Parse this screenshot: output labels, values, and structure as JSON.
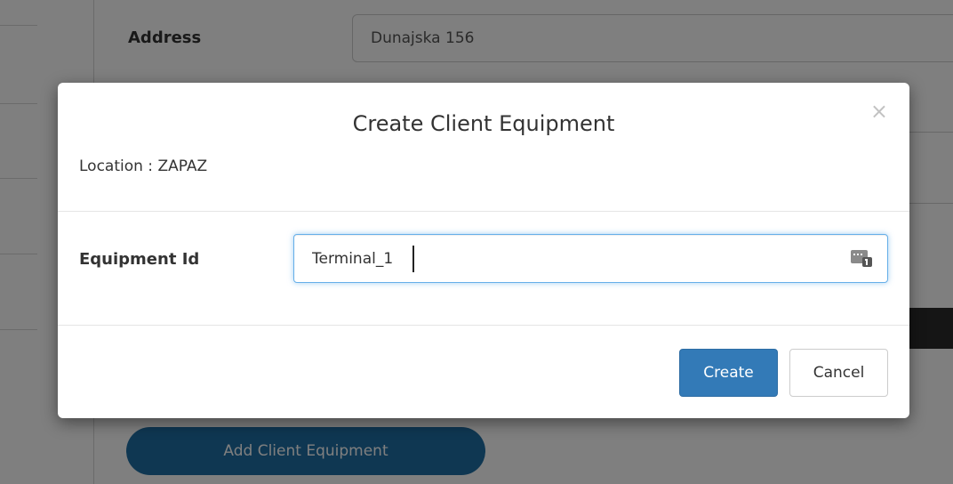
{
  "background": {
    "address_label": "Address",
    "address_value": "Dunajska 156",
    "add_equipment_button": "Add Client Equipment"
  },
  "modal": {
    "title": "Create Client Equipment",
    "close_symbol": "×",
    "location_label": "Location : ",
    "location_value": "ZAPAZ",
    "equipment_id_label": "Equipment Id",
    "equipment_id_value": "Terminal_1",
    "create_label": "Create",
    "cancel_label": "Cancel"
  },
  "icons": {
    "field_icon": "autofill-card-icon",
    "close_icon": "close-icon"
  },
  "colors": {
    "primary": "#337ab7",
    "add_button": "#1f6fa4",
    "focus_border": "#66afe9",
    "backdrop": "rgba(0,0,0,0.5)"
  }
}
